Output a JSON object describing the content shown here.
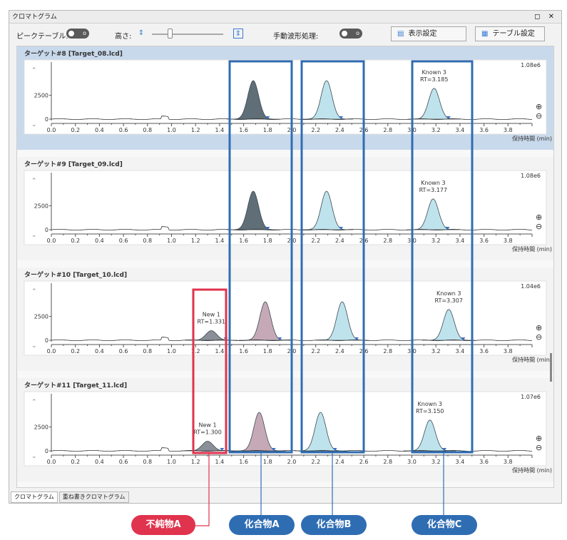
{
  "window": {
    "title": "クロマトグラム",
    "controls": "◻ ✕"
  },
  "toolbar": {
    "peak_table_label": "ピークテーブル:",
    "height_label": "高さ:",
    "manual_label": "手動波形処理:",
    "display_settings_label": "表示設定",
    "table_settings_label": "テーブル設定"
  },
  "tabs": [
    "クロマトグラム",
    "重ね書きクロマトグラム"
  ],
  "colors": {
    "accent_blue": "#2f6db3",
    "accent_red": "#e0334d",
    "panel_selected": "#c9d9ec"
  },
  "callouts": [
    {
      "label": "不純物A"
    },
    {
      "label": "化合物A"
    },
    {
      "label": "化合物B"
    },
    {
      "label": "化合物C"
    }
  ],
  "chart_data": [
    {
      "type": "line",
      "title": "ターゲット#8 [Target_08.lcd]",
      "scale_label": "1.08e6",
      "xlabel": "保持時間 (min)",
      "xlim": [
        0,
        4.0
      ],
      "y_ticks": [
        "2500",
        "0"
      ],
      "x_ticks": [
        "0.0",
        "0.2",
        "0.4",
        "0.6",
        "0.8",
        "1.0",
        "1.2",
        "1.4",
        "1.6",
        "1.8",
        "2.0",
        "2.2",
        "2.4",
        "2.6",
        "2.8",
        "3.0",
        "3.2",
        "3.4",
        "3.6",
        "3.8"
      ],
      "annotations": [
        {
          "text": "Known 3"
        },
        {
          "text": "RT=3.185"
        }
      ],
      "peaks": [
        {
          "rt": 1.68,
          "height": 1.0,
          "fill": "#5f6e77"
        },
        {
          "rt": 2.29,
          "height": 1.0,
          "fill": "#bfe3ec"
        },
        {
          "rt": 3.185,
          "height": 0.8,
          "fill": "#bfe3ec"
        }
      ],
      "selected": true
    },
    {
      "type": "line",
      "title": "ターゲット#9 [Target_09.lcd]",
      "scale_label": "1.08e6",
      "xlabel": "保持時間 (min)",
      "xlim": [
        0,
        4.0
      ],
      "y_ticks": [
        "2500",
        "0"
      ],
      "x_ticks": [
        "0.0",
        "0.2",
        "0.4",
        "0.6",
        "0.8",
        "1.0",
        "1.2",
        "1.4",
        "1.6",
        "1.8",
        "2.0",
        "2.2",
        "2.4",
        "2.6",
        "2.8",
        "3.0",
        "3.2",
        "3.4",
        "3.6",
        "3.8"
      ],
      "annotations": [
        {
          "text": "Known 3"
        },
        {
          "text": "RT=3.177"
        }
      ],
      "peaks": [
        {
          "rt": 1.68,
          "height": 1.0,
          "fill": "#5f6e77"
        },
        {
          "rt": 2.29,
          "height": 1.0,
          "fill": "#bfe3ec"
        },
        {
          "rt": 3.177,
          "height": 0.8,
          "fill": "#bfe3ec"
        }
      ],
      "selected": false
    },
    {
      "type": "line",
      "title": "ターゲット#10 [Target_10.lcd]",
      "scale_label": "1.04e6",
      "xlabel": "保持時間 (min)",
      "xlim": [
        0,
        4.0
      ],
      "y_ticks": [
        "2500",
        "0"
      ],
      "x_ticks": [
        "0.0",
        "0.2",
        "0.4",
        "0.6",
        "0.8",
        "1.0",
        "1.2",
        "1.4",
        "1.6",
        "1.8",
        "2.0",
        "2.2",
        "2.4",
        "2.6",
        "2.8",
        "3.0",
        "3.2",
        "3.4",
        "3.6",
        "3.8"
      ],
      "annotations": [
        {
          "text": "New 1"
        },
        {
          "text": "RT=1.331"
        },
        {
          "text": "Known 3"
        },
        {
          "text": "RT=3.307"
        }
      ],
      "peaks": [
        {
          "rt": 1.331,
          "height": 0.25,
          "fill": "#8a8f98"
        },
        {
          "rt": 1.78,
          "height": 1.0,
          "fill": "#c6a9b7"
        },
        {
          "rt": 2.42,
          "height": 1.0,
          "fill": "#bfe3ec"
        },
        {
          "rt": 3.307,
          "height": 0.8,
          "fill": "#bfe3ec"
        }
      ],
      "selected": false
    },
    {
      "type": "line",
      "title": "ターゲット#11 [Target_11.lcd]",
      "scale_label": "1.07e6",
      "xlabel": "保持時間 (min)",
      "xlim": [
        0,
        4.0
      ],
      "y_ticks": [
        "2500",
        "0"
      ],
      "x_ticks": [
        "0.0",
        "0.2",
        "0.4",
        "0.6",
        "0.8",
        "1.0",
        "1.2",
        "1.4",
        "1.6",
        "1.8",
        "2.0",
        "2.2",
        "2.4",
        "2.6",
        "2.8",
        "3.0",
        "3.2",
        "3.4",
        "3.6",
        "3.8"
      ],
      "annotations": [
        {
          "text": "New 1"
        },
        {
          "text": "RT=1.300"
        },
        {
          "text": "Known 3"
        },
        {
          "text": "RT=3.150"
        }
      ],
      "peaks": [
        {
          "rt": 1.3,
          "height": 0.25,
          "fill": "#8a8f98"
        },
        {
          "rt": 1.73,
          "height": 1.0,
          "fill": "#c6a9b7"
        },
        {
          "rt": 2.24,
          "height": 1.0,
          "fill": "#bfe3ec"
        },
        {
          "rt": 3.15,
          "height": 0.8,
          "fill": "#bfe3ec"
        }
      ],
      "selected": false
    }
  ]
}
